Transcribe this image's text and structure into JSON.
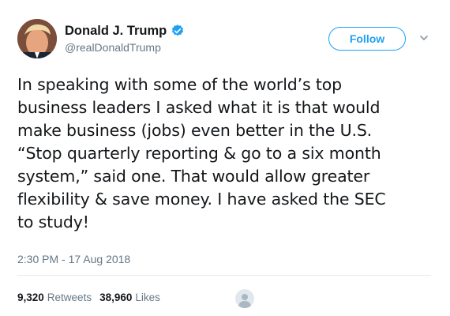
{
  "author": {
    "name": "Donald J. Trump",
    "handle": "@realDonaldTrump",
    "verified_icon": "verified-badge-icon",
    "avatar_icon": "profile-photo"
  },
  "follow_button": {
    "label": "Follow"
  },
  "menu": {
    "icon": "chevron-down-icon"
  },
  "tweet": {
    "lines": [
      "In speaking with some of the world’s top",
      "business leaders I asked what it is that would",
      "make business (jobs) even better in the U.S.",
      "“Stop quarterly reporting & go to a six month",
      "system,” said one. That would allow greater",
      "flexibility & save money. I have asked the SEC",
      "to study!"
    ],
    "timestamp": "2:30 PM - 17 Aug 2018"
  },
  "stats": {
    "retweets_count": "9,320",
    "retweets_label": "Retweets",
    "likes_count": "38,960",
    "likes_label": "Likes"
  },
  "colors": {
    "accent": "#1da1f2",
    "secondary_text": "#657786",
    "primary_text": "#14171a"
  }
}
